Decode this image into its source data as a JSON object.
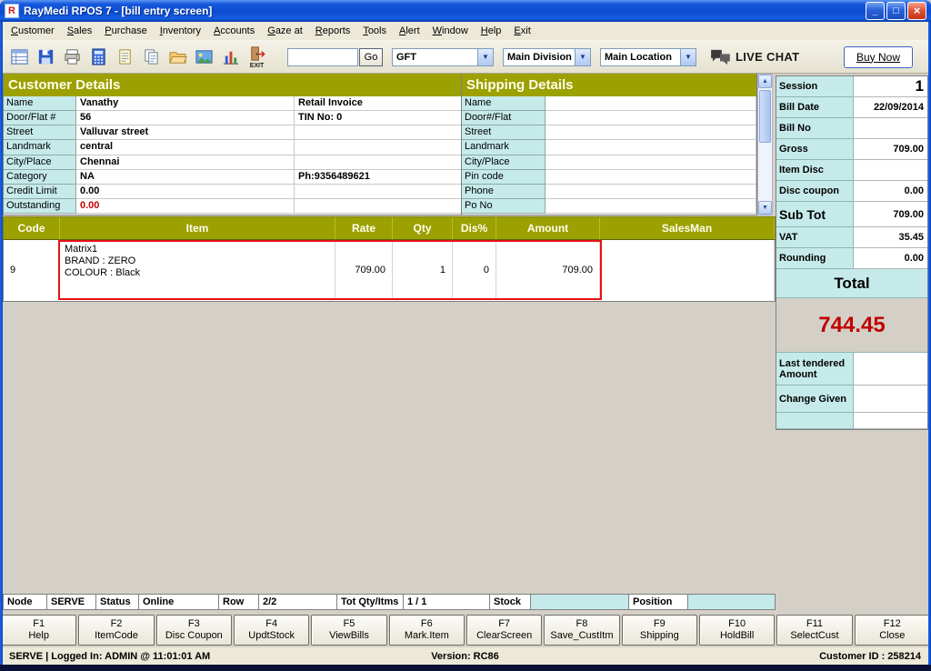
{
  "window": {
    "title": "RayMedi RPOS 7 - [bill entry screen]",
    "logo_letter": "R",
    "controls": {
      "minimize": "_",
      "maximize": "□",
      "close": "×"
    }
  },
  "menu": {
    "items": [
      "Customer",
      "Sales",
      "Purchase",
      "Inventory",
      "Accounts",
      "Gaze at",
      "Reports",
      "Tools",
      "Alert",
      "Window",
      "Help",
      "Exit"
    ]
  },
  "toolbar": {
    "icons": [
      "invoice-icon",
      "save-icon",
      "printer-icon",
      "calculator-icon",
      "notepad-icon",
      "documents-icon",
      "folder-open-icon",
      "photo-icon",
      "chart-icon",
      "exit-icon"
    ],
    "exit_label": "EXIT",
    "search_value": "",
    "go_label": "Go",
    "combo_arrow": "▼",
    "dropdowns": [
      {
        "value": "GFT"
      },
      {
        "value": "Main Division"
      },
      {
        "value": "Main Location"
      }
    ],
    "live_chat_label": "LIVE CHAT",
    "buy_now_label": "Buy Now"
  },
  "scrollbar": {
    "up": "▲",
    "down": "▼"
  },
  "customer": {
    "title": "Customer Details",
    "rows": [
      {
        "label": "Name",
        "value": "Vanathy",
        "value2": "Retail Invoice"
      },
      {
        "label": "Door/Flat #",
        "value": "56",
        "value2": "TIN No: 0"
      },
      {
        "label": "Street",
        "value": "Valluvar street",
        "value2": ""
      },
      {
        "label": "Landmark",
        "value": "central",
        "value2": ""
      },
      {
        "label": "City/Place",
        "value": "Chennai",
        "value2": ""
      },
      {
        "label": "Category",
        "value": "NA",
        "value2": "Ph:9356489621"
      },
      {
        "label": "Credit Limit",
        "value": "0.00",
        "value2": ""
      },
      {
        "label": "Outstanding",
        "value": "0.00",
        "value2": ""
      }
    ]
  },
  "shipping": {
    "title": "Shipping Details",
    "rows": [
      {
        "label": "Name",
        "value": ""
      },
      {
        "label": "Door#/Flat",
        "value": ""
      },
      {
        "label": "Street",
        "value": ""
      },
      {
        "label": "Landmark",
        "value": ""
      },
      {
        "label": "City/Place",
        "value": ""
      },
      {
        "label": "Pin code",
        "value": ""
      },
      {
        "label": "Phone",
        "value": ""
      },
      {
        "label": "Po No",
        "value": ""
      }
    ]
  },
  "summary": {
    "rows": [
      {
        "label": "Session",
        "value": "1"
      },
      {
        "label": "Bill Date",
        "value": "22/09/2014"
      },
      {
        "label": "Bill No",
        "value": ""
      },
      {
        "label": "Gross",
        "value": "709.00"
      },
      {
        "label": "Item Disc",
        "value": ""
      },
      {
        "label": "Disc coupon",
        "value": "0.00"
      },
      {
        "label": "Sub Tot",
        "value": "709.00"
      },
      {
        "label": "VAT",
        "value": "35.45"
      },
      {
        "label": "Rounding",
        "value": "0.00"
      }
    ],
    "total_label": "Total",
    "total_value": "744.45",
    "last_tendered_label": "Last tendered Amount",
    "last_tendered_value": "",
    "change_given_label": "Change Given",
    "change_given_value": ""
  },
  "items_table": {
    "headers": [
      "Code",
      "Item",
      "Rate",
      "Qty",
      "Dis%",
      "Amount",
      "SalesMan"
    ],
    "row": {
      "code": "9",
      "item_line1": "Matrix1",
      "item_line2": "BRAND : ZERO",
      "item_line3": "COLOUR : Black",
      "rate": "709.00",
      "qty": "1",
      "dis": "0",
      "amount": "709.00",
      "salesman": ""
    }
  },
  "status_bar": {
    "cells": [
      "Node",
      "SERVE",
      "Status",
      "Online",
      "Row",
      "2/2",
      "Tot Qty/Itms",
      "1 / 1",
      "Stock",
      "",
      "Position",
      ""
    ]
  },
  "function_keys": [
    {
      "key": "F1",
      "label": "Help"
    },
    {
      "key": "F2",
      "label": "ItemCode"
    },
    {
      "key": "F3",
      "label": "Disc Coupon"
    },
    {
      "key": "F4",
      "label": "UpdtStock"
    },
    {
      "key": "F5",
      "label": "ViewBills"
    },
    {
      "key": "F6",
      "label": "Mark.Item"
    },
    {
      "key": "F7",
      "label": "ClearScreen"
    },
    {
      "key": "F8",
      "label": "Save_CustItm"
    },
    {
      "key": "F9",
      "label": "Shipping"
    },
    {
      "key": "F10",
      "label": "HoldBill"
    },
    {
      "key": "F11",
      "label": "SelectCust"
    },
    {
      "key": "F12",
      "label": "Close"
    }
  ],
  "footer": {
    "left": "SERVE | Logged In: ADMIN @ 11:01:01 AM",
    "center": "Version: RC86",
    "right": "Customer ID : 258214"
  },
  "colors": {
    "header_olive": "#9CA000",
    "label_cyan": "#C6EAEA",
    "total_red": "#C00000",
    "titlebar_blue": "#0C4CD0"
  }
}
